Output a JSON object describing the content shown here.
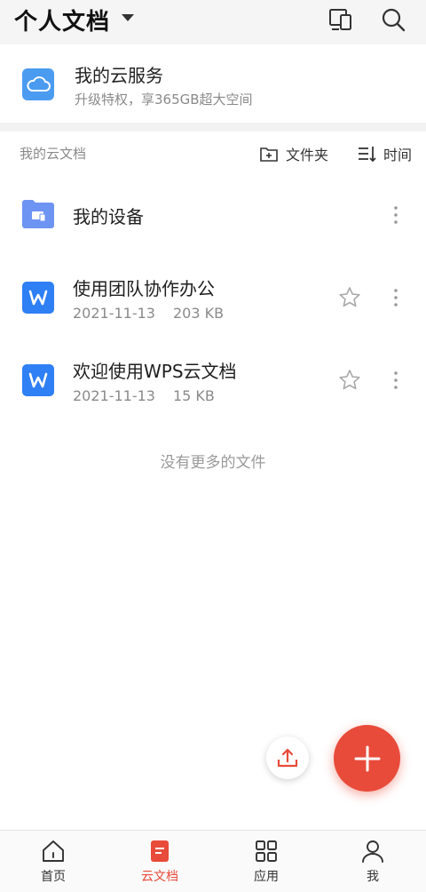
{
  "header": {
    "title": "个人文档",
    "icons": [
      "devices-icon",
      "search-icon"
    ]
  },
  "cloud_service": {
    "title": "我的云服务",
    "subtitle": "升级特权，享365GB超大空间",
    "icon": "cloud-icon"
  },
  "section": {
    "label": "我的云文档",
    "new_folder_label": "文件夹",
    "sort_label": "时间"
  },
  "files": [
    {
      "title": "我的设备",
      "icon": "device-folder-icon"
    },
    {
      "title": "使用团队协作办公",
      "date": "2021-11-13",
      "size": "203 KB",
      "icon": "wps-doc-icon",
      "starred": false
    },
    {
      "title": "欢迎使用WPS云文档",
      "date": "2021-11-13",
      "size": "15 KB",
      "icon": "wps-doc-icon",
      "starred": false
    }
  ],
  "end_message": "没有更多的文件",
  "bottom_nav": {
    "items": [
      {
        "label": "首页",
        "icon": "home-icon",
        "active": false
      },
      {
        "label": "云文档",
        "icon": "cloud-doc-icon",
        "active": true
      },
      {
        "label": "应用",
        "icon": "apps-grid-icon",
        "active": false
      },
      {
        "label": "我",
        "icon": "user-icon",
        "active": false
      }
    ]
  },
  "colors": {
    "accent": "#e84b3a",
    "doc_blue": "#2f7ff5",
    "cloud_blue": "#4b9bf1",
    "folder_blue": "#6d93f3"
  }
}
